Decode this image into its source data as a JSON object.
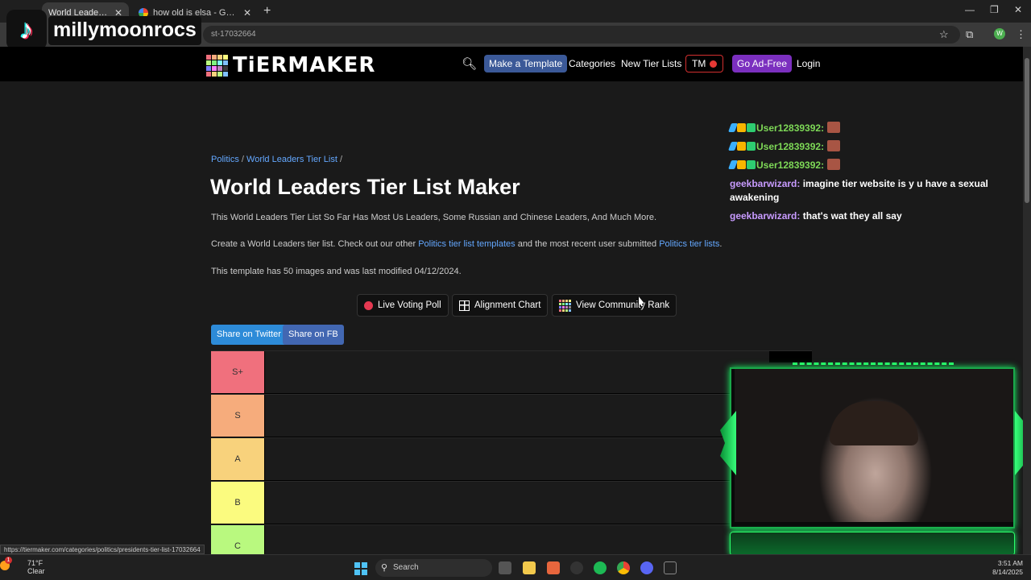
{
  "browser": {
    "tabs": [
      {
        "title": "World Leaders Tier List",
        "active": true
      },
      {
        "title": "how old is elsa - Google Search",
        "active": false
      }
    ],
    "url": "st-17032664",
    "status_url": "https://tiermaker.com/categories/politics/presidents-tier-list-17032664",
    "profile_initial": "W"
  },
  "overlay": {
    "tiktok_name": "millymoonrocs"
  },
  "header": {
    "logo_text": "TiERMAKER",
    "make_template": "Make a Template",
    "categories": "Categories",
    "new_tier_lists": "New Tier Lists",
    "tm": "TM",
    "go_ad_free": "Go Ad-Free",
    "login": "Login",
    "colors": {
      "make_template": "#3b5998",
      "ad_free": "#7b2fbf",
      "tm_dot": "#e53935"
    }
  },
  "breadcrumb": {
    "category": "Politics",
    "separator1": " / ",
    "list": "World Leaders Tier List",
    "separator2": " /"
  },
  "page": {
    "title": "World Leaders Tier List Maker",
    "description": "This World Leaders Tier List So Far Has Most Us Leaders, Some Russian and Chinese Leaders, And Much More.",
    "create_prefix": "Create a World Leaders tier list. Check out our other ",
    "create_link1": "Politics tier list templates",
    "create_middle": " and the most recent user submitted ",
    "create_link2": "Politics tier lists",
    "create_suffix": ".",
    "template_info": "This template has 50 images and was last modified 04/12/2024."
  },
  "buttons": {
    "live_poll": "Live Voting Poll",
    "alignment": "Alignment Chart",
    "community": "View Community Rank",
    "share_twitter": "Share on Twitter",
    "share_fb": "Share on FB"
  },
  "tiers": [
    {
      "label": "S+",
      "color": "#f0707d"
    },
    {
      "label": "S",
      "color": "#f6ac7c"
    },
    {
      "label": "A",
      "color": "#f8d27c"
    },
    {
      "label": "B",
      "color": "#fbfb7f"
    },
    {
      "label": "C",
      "color": "#b9f97f"
    }
  ],
  "chat": [
    {
      "user": "User12839392:",
      "message": "",
      "badges": true,
      "emote": true,
      "color": "green"
    },
    {
      "user": "User12839392:",
      "message": "",
      "badges": true,
      "emote": true,
      "color": "green"
    },
    {
      "user": "User12839392:",
      "message": "",
      "badges": true,
      "emote": true,
      "color": "green"
    },
    {
      "user": "geekbarwizard:",
      "message": "imagine tier website is y u have a sexual awakening",
      "badges": false,
      "emote": false,
      "color": "purple"
    },
    {
      "user": "geekbarwizard:",
      "message": "that's wat they all say",
      "badges": false,
      "emote": false,
      "color": "purple"
    }
  ],
  "taskbar": {
    "weather_temp": "71°F",
    "weather_desc": "Clear",
    "weather_badge": "1",
    "search": "Search",
    "time": "3:51 AM",
    "date": "8/14/2025"
  }
}
